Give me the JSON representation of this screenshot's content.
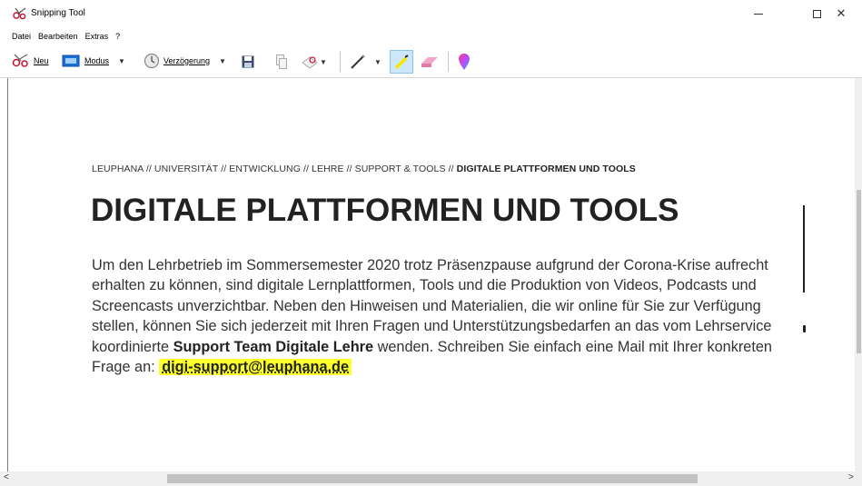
{
  "window": {
    "title": "Snipping Tool",
    "minimize_glyph": "—",
    "close_glyph": "✕"
  },
  "menu": {
    "items": [
      "Datei",
      "Bearbeiten",
      "Extras",
      "?"
    ]
  },
  "toolbar": {
    "new_label": "Neu",
    "mode_label": "Modus",
    "delay_label": "Verzögerung",
    "caret": "▼"
  },
  "document": {
    "breadcrumb_prefix": "LEUPHANA // UNIVERSITÄT // ENTWICKLUNG // LEHRE // SUPPORT & TOOLS // ",
    "breadcrumb_current": "DIGITALE PLATTFORMEN UND TOOLS",
    "title": "DIGITALE PLATTFORMEN UND TOOLS",
    "body_part1": "Um den Lehrbetrieb im Sommersemester 2020 trotz Präsenzpause aufgrund der Corona-Krise aufrecht erhalten zu können, sind digitale Lernplattformen, Tools und die Produktion von Videos, Podcasts und Screencasts unverzichtbar. Neben den Hinweisen und Materialien, die wir online für Sie zur Verfügung stellen, können Sie sich jederzeit mit Ihren Fragen und Unterstützungsbedarfen an das vom Lehrservice koordinierte ",
    "body_strong": "Support Team Digitale Lehre",
    "body_part2": " wenden. Schreiben Sie einfach eine Mail mit Ihrer konkreten Frage an: ",
    "email": "digi-support@leuphana.de"
  },
  "scrollbar": {
    "left_arrow": "<",
    "right_arrow": ">"
  },
  "colors": {
    "highlight": "#fbff2a",
    "text": "#333333"
  }
}
